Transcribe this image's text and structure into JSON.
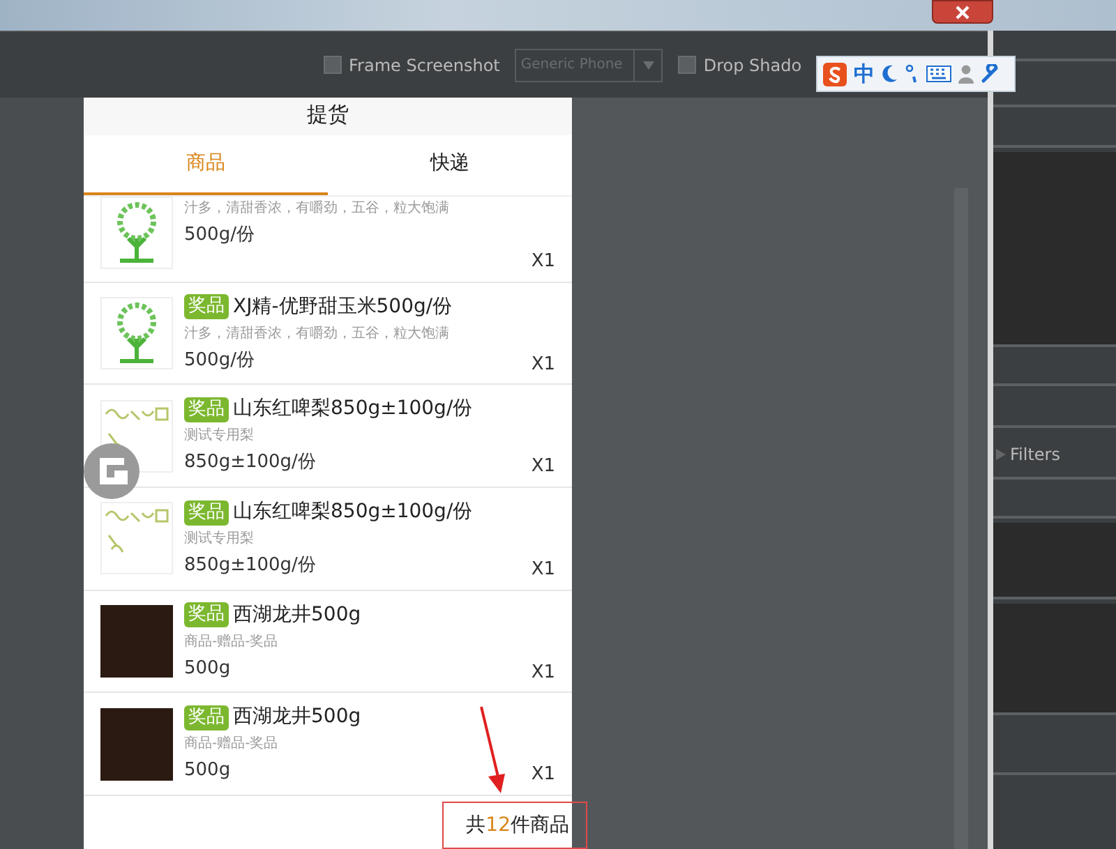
{
  "toolbar": {
    "frame_screenshot": {
      "label": "Frame Screenshot",
      "checked": false
    },
    "device_select": {
      "value": "Generic Phone",
      "disabled": true
    },
    "drop_shadow": {
      "label": "Drop Shado",
      "checked": false
    }
  },
  "ime_toolbar": {
    "mode": "中"
  },
  "phone": {
    "title": "提货",
    "tabs": [
      {
        "label": "商品",
        "selected": true
      },
      {
        "label": "快递",
        "selected": false
      }
    ],
    "items": [
      {
        "kind": "tree",
        "description": "汁多，清甜香浓，有嚼劲，五谷，粒大饱满",
        "weight": "500g/份",
        "quantity": "X1"
      },
      {
        "kind": "tree",
        "badge": "奖品",
        "title": "XJ精-优野甜玉米500g/份",
        "description": "汁多，清甜香浓，有嚼劲，五谷，粒大饱满",
        "weight": "500g/份",
        "quantity": "X1"
      },
      {
        "kind": "sketch",
        "badge": "奖品",
        "title": "山东红啤梨850g±100g/份",
        "description": "测试专用梨",
        "weight": "850g±100g/份",
        "quantity": "X1"
      },
      {
        "kind": "sketch",
        "badge": "奖品",
        "title": "山东红啤梨850g±100g/份",
        "description": "测试专用梨",
        "weight": "850g±100g/份",
        "quantity": "X1"
      },
      {
        "kind": "photo",
        "badge": "奖品",
        "title": "西湖龙井500g",
        "description": "商品-赠品-奖品",
        "weight": "500g",
        "quantity": "X1"
      },
      {
        "kind": "photo",
        "badge": "奖品",
        "title": "西湖龙井500g",
        "description": "商品-赠品-奖品",
        "weight": "500g",
        "quantity": "X1"
      }
    ],
    "total": {
      "prefix": "共",
      "count": "12",
      "suffix": "件商品"
    }
  },
  "side_panel": {
    "label": "Filters"
  }
}
